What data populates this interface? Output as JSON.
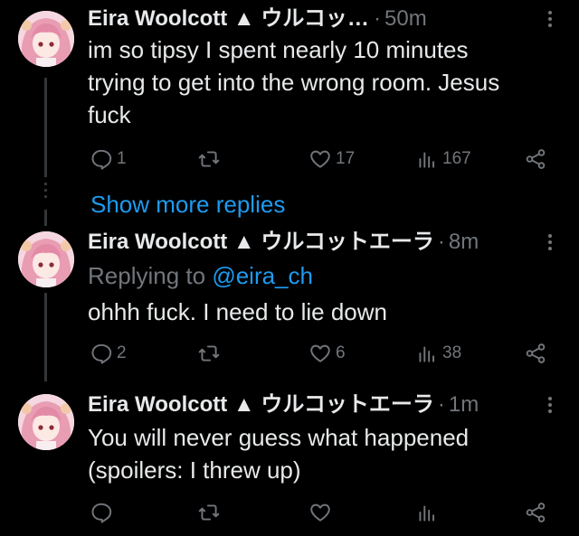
{
  "colors": {
    "background": "#000000",
    "text": "#e7e9ea",
    "muted": "#71767b",
    "accent": "#1d9bf0",
    "thread_line": "#333639"
  },
  "tweets": [
    {
      "name": "Eira Woolcott ▲ ウルコットエ...",
      "time": "50m",
      "replying_prefix": "",
      "replying_handle": "",
      "text_lines": [
        "im so tipsy I spent nearly 10 minutes",
        "trying to get into the wrong room. Jesus",
        "fuck"
      ],
      "replies": "1",
      "retweets": "",
      "likes": "17",
      "views": "167",
      "icons": {
        "reply": "reply-icon",
        "retweet": "retweet-icon",
        "like": "heart-icon",
        "views": "views-icon",
        "share": "share-icon",
        "more": "more-icon"
      }
    },
    {
      "name": "Eira Woolcott ▲ ウルコットエーラ",
      "time": "8m",
      "replying_prefix": "Replying to ",
      "replying_handle": "@eira_ch",
      "text_lines": [
        "ohhh fuck. I need to lie down"
      ],
      "replies": "2",
      "retweets": "",
      "likes": "6",
      "views": "38"
    },
    {
      "name": "Eira Woolcott ▲ ウルコットエーラ",
      "time": "1m",
      "replying_prefix": "",
      "replying_handle": "",
      "text_lines": [
        "You will never guess what happened",
        "(spoilers: I threw up)"
      ],
      "replies": "",
      "retweets": "",
      "likes": "",
      "views": ""
    }
  ],
  "show_more_replies": "Show more replies"
}
